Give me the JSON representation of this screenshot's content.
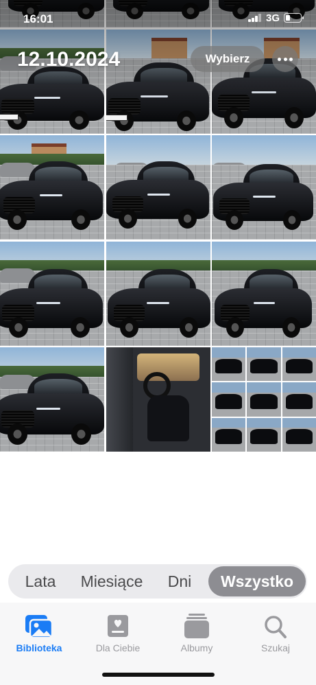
{
  "status_bar": {
    "time": "16:01",
    "network": "3G",
    "battery_level": 0.3
  },
  "header": {
    "date": "12.10.2024",
    "select_label": "Wybierz",
    "more_icon": "ellipsis-icon"
  },
  "segments": [
    {
      "label": "Lata",
      "active": false
    },
    {
      "label": "Miesiące",
      "active": false
    },
    {
      "label": "Dni",
      "active": false
    },
    {
      "label": "Wszystko",
      "active": true
    }
  ],
  "tabs": [
    {
      "label": "Biblioteka",
      "icon": "photo-library-icon",
      "active": true
    },
    {
      "label": "Dla Ciebie",
      "icon": "for-you-icon",
      "active": false
    },
    {
      "label": "Albumy",
      "icon": "albums-icon",
      "active": false
    },
    {
      "label": "Szukaj",
      "icon": "search-icon",
      "active": false
    }
  ],
  "colors": {
    "accent": "#1a7cf5",
    "tab_inactive": "#9a9a9e",
    "segment_active": "#8d8d92"
  },
  "grid": {
    "photo_count": 18
  }
}
